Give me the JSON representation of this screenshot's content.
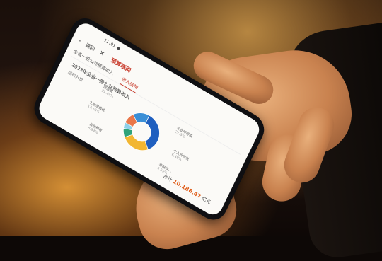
{
  "scene": {
    "description_tag": "photo-of-hands-holding-phone"
  },
  "phone": {
    "status_bar": "11:01 ■",
    "nav": {
      "back_icon": "chevron-left-icon",
      "close_icon": "close-icon",
      "title": "预算联网",
      "back_label": "返回"
    },
    "tabs": [
      {
        "label": "全省一般公共预算收入",
        "active": false
      },
      {
        "label": "收入结构",
        "active": true
      }
    ],
    "subtitle": "2023年全省一般公共预算收入",
    "caption": "结构分析",
    "labels": {
      "tl": {
        "name": "增值税",
        "pct": "31.49%"
      },
      "tr": {
        "name": "企业所得税",
        "pct": "21.6%"
      },
      "r": {
        "name": "个人所得税",
        "pct": "6.49%"
      },
      "br": {
        "name": "非税收入",
        "pct": "4.55%"
      },
      "bl": {
        "name": "其他税收",
        "pct": "8.94%"
      },
      "l": {
        "name": "土地增值税",
        "pct": "12.66%"
      }
    },
    "total": {
      "label": "合计",
      "value": "10,186.47",
      "unit": "亿元"
    }
  },
  "chart_data": {
    "type": "pie",
    "categories": [
      "增值税",
      "企业所得税",
      "个人所得税",
      "非税收入",
      "其他税收",
      "土地增值税"
    ],
    "values": [
      31.49,
      21.6,
      6.49,
      4.55,
      8.94,
      12.66
    ],
    "colors": [
      "#1f5fbf",
      "#f2b632",
      "#2fa37a",
      "#8fd0e8",
      "#e9774a",
      "#3b8fd6"
    ],
    "title": "2023年全省一般公共预算收入"
  }
}
